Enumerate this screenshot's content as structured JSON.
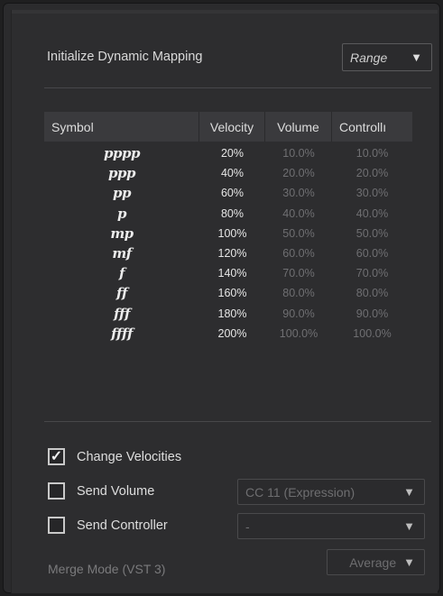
{
  "header": {
    "title": "Initialize Dynamic Mapping",
    "range_value": "Range",
    "arrow": "▼"
  },
  "table": {
    "columns": [
      "Symbol",
      "Velocity",
      "Volume",
      "Controllı"
    ],
    "rows": [
      {
        "symbol": "pppp",
        "velocity": "20%",
        "volume": "10.0%",
        "controller": "10.0%"
      },
      {
        "symbol": "ppp",
        "velocity": "40%",
        "volume": "20.0%",
        "controller": "20.0%"
      },
      {
        "symbol": "pp",
        "velocity": "60%",
        "volume": "30.0%",
        "controller": "30.0%"
      },
      {
        "symbol": "p",
        "velocity": "80%",
        "volume": "40.0%",
        "controller": "40.0%"
      },
      {
        "symbol": "mp",
        "velocity": "100%",
        "volume": "50.0%",
        "controller": "50.0%"
      },
      {
        "symbol": "mf",
        "velocity": "120%",
        "volume": "60.0%",
        "controller": "60.0%"
      },
      {
        "symbol": "f",
        "velocity": "140%",
        "volume": "70.0%",
        "controller": "70.0%"
      },
      {
        "symbol": "ff",
        "velocity": "160%",
        "volume": "80.0%",
        "controller": "80.0%"
      },
      {
        "symbol": "fff",
        "velocity": "180%",
        "volume": "90.0%",
        "controller": "90.0%"
      },
      {
        "symbol": "ffff",
        "velocity": "200%",
        "volume": "100.0%",
        "controller": "100.0%"
      }
    ]
  },
  "options": {
    "change_velocities": {
      "label": "Change Velocities",
      "checked": true,
      "tick": "✓"
    },
    "send_volume": {
      "label": "Send Volume",
      "checked": false,
      "value": "CC 11 (Expression)"
    },
    "send_controller": {
      "label": "Send Controller",
      "checked": false,
      "value": "-"
    },
    "merge_mode": {
      "label": "Merge Mode (VST 3)",
      "value": "Average"
    }
  }
}
